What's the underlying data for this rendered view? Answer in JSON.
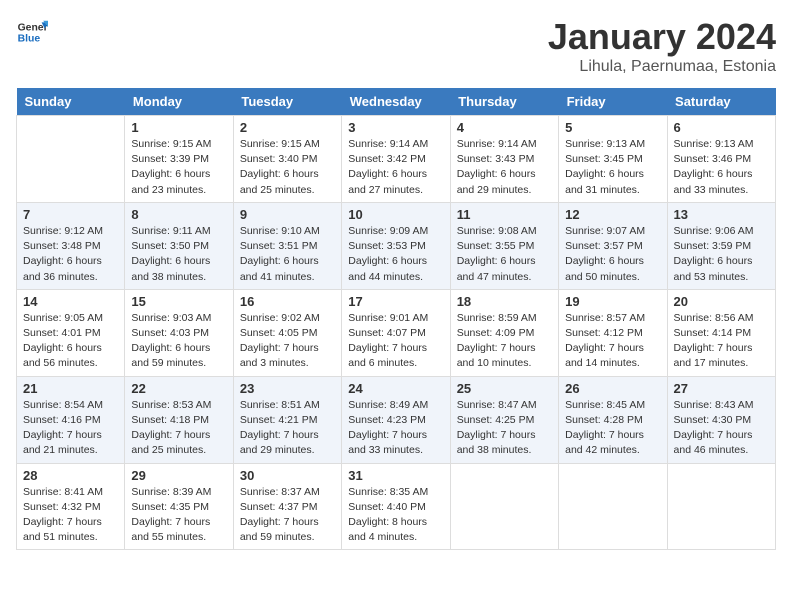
{
  "header": {
    "logo_general": "General",
    "logo_blue": "Blue",
    "month_title": "January 2024",
    "subtitle": "Lihula, Paernumaa, Estonia"
  },
  "weekdays": [
    "Sunday",
    "Monday",
    "Tuesday",
    "Wednesday",
    "Thursday",
    "Friday",
    "Saturday"
  ],
  "weeks": [
    [
      {
        "day": "",
        "sunrise": "",
        "sunset": "",
        "daylight": ""
      },
      {
        "day": "1",
        "sunrise": "Sunrise: 9:15 AM",
        "sunset": "Sunset: 3:39 PM",
        "daylight": "Daylight: 6 hours and 23 minutes."
      },
      {
        "day": "2",
        "sunrise": "Sunrise: 9:15 AM",
        "sunset": "Sunset: 3:40 PM",
        "daylight": "Daylight: 6 hours and 25 minutes."
      },
      {
        "day": "3",
        "sunrise": "Sunrise: 9:14 AM",
        "sunset": "Sunset: 3:42 PM",
        "daylight": "Daylight: 6 hours and 27 minutes."
      },
      {
        "day": "4",
        "sunrise": "Sunrise: 9:14 AM",
        "sunset": "Sunset: 3:43 PM",
        "daylight": "Daylight: 6 hours and 29 minutes."
      },
      {
        "day": "5",
        "sunrise": "Sunrise: 9:13 AM",
        "sunset": "Sunset: 3:45 PM",
        "daylight": "Daylight: 6 hours and 31 minutes."
      },
      {
        "day": "6",
        "sunrise": "Sunrise: 9:13 AM",
        "sunset": "Sunset: 3:46 PM",
        "daylight": "Daylight: 6 hours and 33 minutes."
      }
    ],
    [
      {
        "day": "7",
        "sunrise": "Sunrise: 9:12 AM",
        "sunset": "Sunset: 3:48 PM",
        "daylight": "Daylight: 6 hours and 36 minutes."
      },
      {
        "day": "8",
        "sunrise": "Sunrise: 9:11 AM",
        "sunset": "Sunset: 3:50 PM",
        "daylight": "Daylight: 6 hours and 38 minutes."
      },
      {
        "day": "9",
        "sunrise": "Sunrise: 9:10 AM",
        "sunset": "Sunset: 3:51 PM",
        "daylight": "Daylight: 6 hours and 41 minutes."
      },
      {
        "day": "10",
        "sunrise": "Sunrise: 9:09 AM",
        "sunset": "Sunset: 3:53 PM",
        "daylight": "Daylight: 6 hours and 44 minutes."
      },
      {
        "day": "11",
        "sunrise": "Sunrise: 9:08 AM",
        "sunset": "Sunset: 3:55 PM",
        "daylight": "Daylight: 6 hours and 47 minutes."
      },
      {
        "day": "12",
        "sunrise": "Sunrise: 9:07 AM",
        "sunset": "Sunset: 3:57 PM",
        "daylight": "Daylight: 6 hours and 50 minutes."
      },
      {
        "day": "13",
        "sunrise": "Sunrise: 9:06 AM",
        "sunset": "Sunset: 3:59 PM",
        "daylight": "Daylight: 6 hours and 53 minutes."
      }
    ],
    [
      {
        "day": "14",
        "sunrise": "Sunrise: 9:05 AM",
        "sunset": "Sunset: 4:01 PM",
        "daylight": "Daylight: 6 hours and 56 minutes."
      },
      {
        "day": "15",
        "sunrise": "Sunrise: 9:03 AM",
        "sunset": "Sunset: 4:03 PM",
        "daylight": "Daylight: 6 hours and 59 minutes."
      },
      {
        "day": "16",
        "sunrise": "Sunrise: 9:02 AM",
        "sunset": "Sunset: 4:05 PM",
        "daylight": "Daylight: 7 hours and 3 minutes."
      },
      {
        "day": "17",
        "sunrise": "Sunrise: 9:01 AM",
        "sunset": "Sunset: 4:07 PM",
        "daylight": "Daylight: 7 hours and 6 minutes."
      },
      {
        "day": "18",
        "sunrise": "Sunrise: 8:59 AM",
        "sunset": "Sunset: 4:09 PM",
        "daylight": "Daylight: 7 hours and 10 minutes."
      },
      {
        "day": "19",
        "sunrise": "Sunrise: 8:57 AM",
        "sunset": "Sunset: 4:12 PM",
        "daylight": "Daylight: 7 hours and 14 minutes."
      },
      {
        "day": "20",
        "sunrise": "Sunrise: 8:56 AM",
        "sunset": "Sunset: 4:14 PM",
        "daylight": "Daylight: 7 hours and 17 minutes."
      }
    ],
    [
      {
        "day": "21",
        "sunrise": "Sunrise: 8:54 AM",
        "sunset": "Sunset: 4:16 PM",
        "daylight": "Daylight: 7 hours and 21 minutes."
      },
      {
        "day": "22",
        "sunrise": "Sunrise: 8:53 AM",
        "sunset": "Sunset: 4:18 PM",
        "daylight": "Daylight: 7 hours and 25 minutes."
      },
      {
        "day": "23",
        "sunrise": "Sunrise: 8:51 AM",
        "sunset": "Sunset: 4:21 PM",
        "daylight": "Daylight: 7 hours and 29 minutes."
      },
      {
        "day": "24",
        "sunrise": "Sunrise: 8:49 AM",
        "sunset": "Sunset: 4:23 PM",
        "daylight": "Daylight: 7 hours and 33 minutes."
      },
      {
        "day": "25",
        "sunrise": "Sunrise: 8:47 AM",
        "sunset": "Sunset: 4:25 PM",
        "daylight": "Daylight: 7 hours and 38 minutes."
      },
      {
        "day": "26",
        "sunrise": "Sunrise: 8:45 AM",
        "sunset": "Sunset: 4:28 PM",
        "daylight": "Daylight: 7 hours and 42 minutes."
      },
      {
        "day": "27",
        "sunrise": "Sunrise: 8:43 AM",
        "sunset": "Sunset: 4:30 PM",
        "daylight": "Daylight: 7 hours and 46 minutes."
      }
    ],
    [
      {
        "day": "28",
        "sunrise": "Sunrise: 8:41 AM",
        "sunset": "Sunset: 4:32 PM",
        "daylight": "Daylight: 7 hours and 51 minutes."
      },
      {
        "day": "29",
        "sunrise": "Sunrise: 8:39 AM",
        "sunset": "Sunset: 4:35 PM",
        "daylight": "Daylight: 7 hours and 55 minutes."
      },
      {
        "day": "30",
        "sunrise": "Sunrise: 8:37 AM",
        "sunset": "Sunset: 4:37 PM",
        "daylight": "Daylight: 7 hours and 59 minutes."
      },
      {
        "day": "31",
        "sunrise": "Sunrise: 8:35 AM",
        "sunset": "Sunset: 4:40 PM",
        "daylight": "Daylight: 8 hours and 4 minutes."
      },
      {
        "day": "",
        "sunrise": "",
        "sunset": "",
        "daylight": ""
      },
      {
        "day": "",
        "sunrise": "",
        "sunset": "",
        "daylight": ""
      },
      {
        "day": "",
        "sunrise": "",
        "sunset": "",
        "daylight": ""
      }
    ]
  ]
}
